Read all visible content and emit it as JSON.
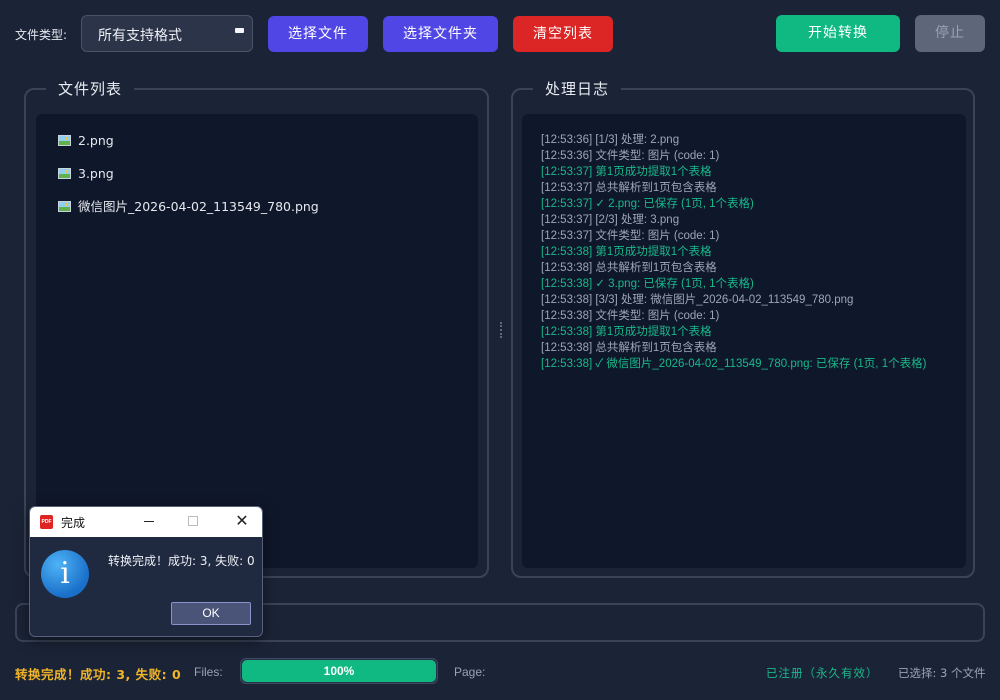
{
  "toolbar": {
    "file_type_label": "文件类型:",
    "file_type_value": "所有支持格式",
    "select_files": "选择文件",
    "select_folder": "选择文件夹",
    "clear_list": "清空列表",
    "start": "开始转换",
    "stop": "停止"
  },
  "file_list": {
    "title": "文件列表",
    "items": [
      "2.png",
      "3.png",
      "微信图片_2026-04-02_113549_780.png"
    ]
  },
  "log": {
    "title": "处理日志",
    "lines": [
      {
        "text": "[12:53:36] [1/3] 处理: 2.png",
        "status": "info"
      },
      {
        "text": "[12:53:36] 文件类型: 图片 (code: 1)",
        "status": "info"
      },
      {
        "text": "[12:53:37] 第1页成功提取1个表格",
        "status": "ok"
      },
      {
        "text": "[12:53:37] 总共解析到1页包含表格",
        "status": "info"
      },
      {
        "text": "[12:53:37] ✓ 2.png: 已保存 (1页, 1个表格)",
        "status": "ok"
      },
      {
        "text": "[12:53:37] [2/3] 处理: 3.png",
        "status": "info"
      },
      {
        "text": "[12:53:37] 文件类型: 图片 (code: 1)",
        "status": "info"
      },
      {
        "text": "[12:53:38] 第1页成功提取1个表格",
        "status": "ok"
      },
      {
        "text": "[12:53:38] 总共解析到1页包含表格",
        "status": "info"
      },
      {
        "text": "[12:53:38] ✓ 3.png: 已保存 (1页, 1个表格)",
        "status": "ok"
      },
      {
        "text": "[12:53:38] [3/3] 处理: 微信图片_2026-04-02_113549_780.png",
        "status": "info"
      },
      {
        "text": "[12:53:38] 文件类型: 图片 (code: 1)",
        "status": "info"
      },
      {
        "text": "[12:53:38] 第1页成功提取1个表格",
        "status": "ok"
      },
      {
        "text": "[12:53:38] 总共解析到1页包含表格",
        "status": "info"
      },
      {
        "text": "[12:53:38] ✓ 微信图片_2026-04-02_113549_780.png: 已保存 (1页, 1个表格)",
        "status": "ok"
      }
    ]
  },
  "status_bar": {
    "message": "转换完成！成功: 3, 失败: 0",
    "files_label": "Files:",
    "progress_percent": 100,
    "progress_text": "100%",
    "page_label": "Page:",
    "registration": "已注册（永久有效）",
    "selected": "已选择: 3 个文件"
  },
  "dialog": {
    "app_icon": "PDF",
    "title": "完成",
    "message": "转换完成！成功: 3, 失败: 0",
    "ok": "OK",
    "icon": "info-icon"
  },
  "colors": {
    "background": "#1b2437",
    "primary": "#4f46e5",
    "danger": "#dc2626",
    "success": "#10b981",
    "warning_text": "#f0b429"
  }
}
